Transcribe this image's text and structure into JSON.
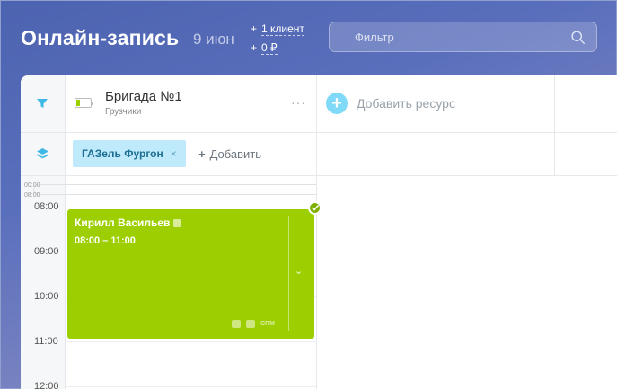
{
  "header": {
    "title": "Онлайн-запись",
    "date": "9 июн",
    "summary": [
      {
        "plus": "+",
        "value": "1 клиент"
      },
      {
        "plus": "+",
        "value": "0 ₽"
      }
    ],
    "filter_placeholder": "Фильтр"
  },
  "resource": {
    "name": "Бригада №1",
    "subtitle": "Грузчики",
    "menu": "···",
    "battery_level": 0.25
  },
  "add_resource_label": "Добавить ресурс",
  "add_resource_plus": "+",
  "tag": {
    "label": "ГАЗель Фургон",
    "remove": "×"
  },
  "add_tag": {
    "plus": "+",
    "label": "Добавить"
  },
  "schedule": {
    "mini_times": [
      "00:00",
      "08:00"
    ],
    "times": [
      "08:00",
      "09:00",
      "10:00",
      "11:00",
      "12:00"
    ],
    "event": {
      "name": "Кирилл Васильев",
      "time_range": "08:00 – 11:00",
      "crm": "CRM",
      "chevron": "⌄"
    }
  },
  "colors": {
    "event_green": "#9dcf00",
    "accent_blue": "#7fd9f7",
    "tag_bg": "#bfeafc"
  }
}
